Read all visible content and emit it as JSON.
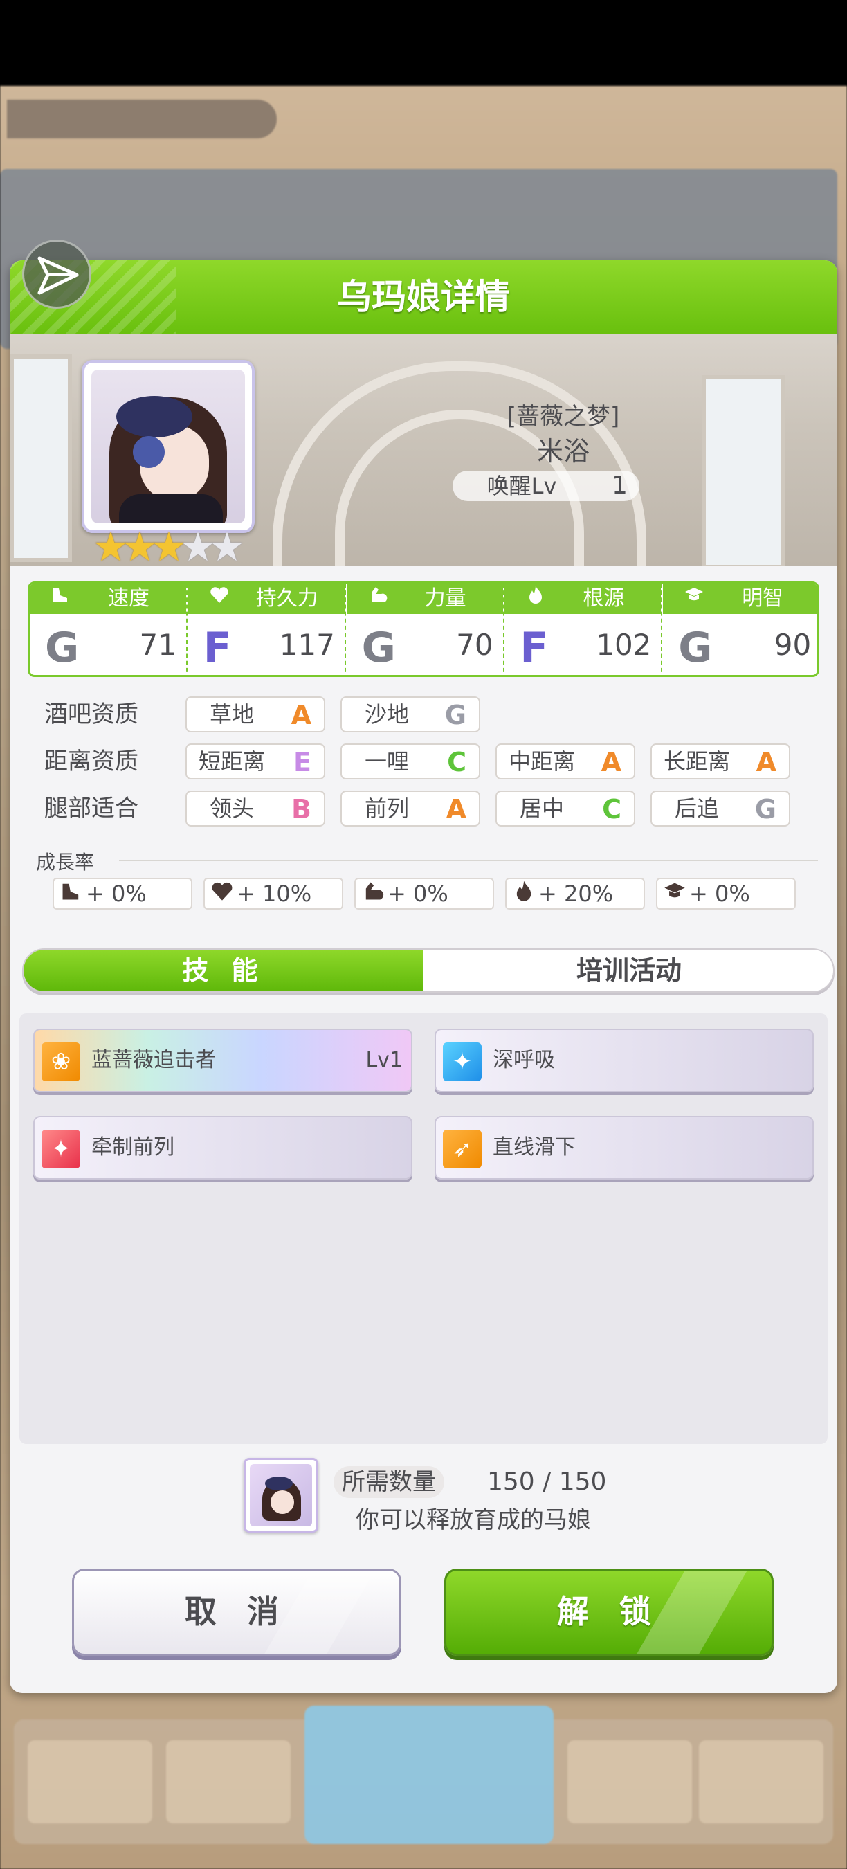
{
  "dialog": {
    "title": "乌玛娘详情"
  },
  "character": {
    "epithet": "[蔷薇之梦]",
    "name": "米浴",
    "awaken_label": "唤醒Lv",
    "awaken_level": "1",
    "stars_filled": 3,
    "stars_total": 5
  },
  "stats": [
    {
      "icon": "shoe-icon",
      "label": "速度",
      "grade": "G",
      "value": "71"
    },
    {
      "icon": "heart-icon",
      "label": "持久力",
      "grade": "F",
      "value": "117"
    },
    {
      "icon": "muscle-icon",
      "label": "力量",
      "grade": "G",
      "value": "70"
    },
    {
      "icon": "flame-icon",
      "label": "根源",
      "grade": "F",
      "value": "102"
    },
    {
      "icon": "graduation-cap-icon",
      "label": "明智",
      "grade": "G",
      "value": "90"
    }
  ],
  "aptitude": {
    "track": {
      "label": "酒吧资质",
      "items": [
        {
          "name": "草地",
          "rank": "A"
        },
        {
          "name": "沙地",
          "rank": "G"
        }
      ]
    },
    "distance": {
      "label": "距离资质",
      "items": [
        {
          "name": "短距离",
          "rank": "E"
        },
        {
          "name": "一哩",
          "rank": "C"
        },
        {
          "name": "中距离",
          "rank": "A"
        },
        {
          "name": "长距离",
          "rank": "A"
        }
      ]
    },
    "style": {
      "label": "腿部适合",
      "items": [
        {
          "name": "领头",
          "rank": "B"
        },
        {
          "name": "前列",
          "rank": "A"
        },
        {
          "name": "居中",
          "rank": "C"
        },
        {
          "name": "后追",
          "rank": "G"
        }
      ]
    }
  },
  "growth": {
    "title": "成長率",
    "items": [
      {
        "icon": "shoe-icon",
        "value": "+ 0%"
      },
      {
        "icon": "heart-icon",
        "value": "+ 10%"
      },
      {
        "icon": "muscle-icon",
        "value": "+ 0%"
      },
      {
        "icon": "flame-icon",
        "value": "+ 20%"
      },
      {
        "icon": "graduation-cap-icon",
        "value": "+ 0%"
      }
    ]
  },
  "tabs": {
    "skills": "技 能",
    "training": "培训活动",
    "active": "skills"
  },
  "skills": [
    {
      "name": "蓝蔷薇追击者",
      "level": "Lv1",
      "icon": "speed-rose-icon"
    },
    {
      "name": "深呼吸",
      "level": "",
      "icon": "sparkle-blue-icon"
    },
    {
      "name": "牵制前列",
      "level": "",
      "icon": "sparkle-red-icon"
    },
    {
      "name": "直线滑下",
      "level": "",
      "icon": "speed-icon"
    }
  ],
  "requirement": {
    "label": "所需数量",
    "count": "150 / 150",
    "note": "你可以释放育成的马娘"
  },
  "buttons": {
    "cancel": "取 消",
    "unlock": "解 锁"
  },
  "colors": {
    "accent_green": "#6fc312",
    "rank_A": "#f08a2a",
    "rank_B": "#e86fa8",
    "rank_C": "#5ec43a",
    "rank_E": "#c78be6",
    "rank_G": "#9a9ca6",
    "grade_F": "#6b5fd0"
  }
}
